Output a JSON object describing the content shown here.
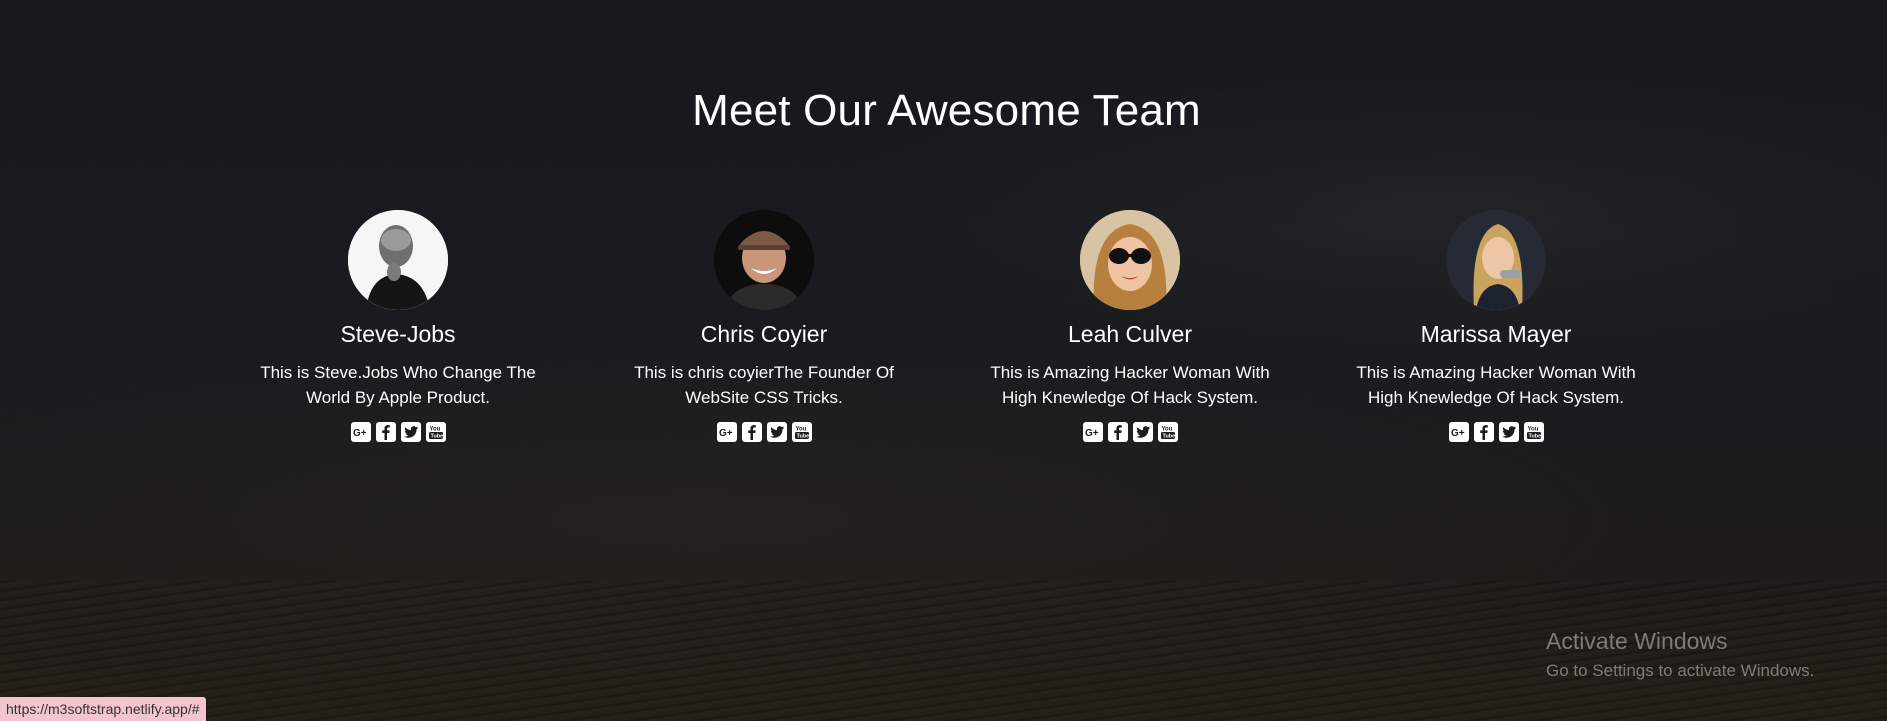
{
  "heading": "Meet Our Awesome Team",
  "team": [
    {
      "name": "Steve-Jobs",
      "desc": "This is Steve.Jobs Who Change The World By Apple Product."
    },
    {
      "name": "Chris Coyier",
      "desc": "This is chris coyierThe Founder Of WebSite CSS Tricks."
    },
    {
      "name": "Leah Culver",
      "desc": "This is Amazing Hacker Woman With High Knewledge Of Hack System."
    },
    {
      "name": "Marissa Mayer",
      "desc": "This is Amazing Hacker Woman With High Knewledge Of Hack System."
    }
  ],
  "social_icons": [
    "google-plus-icon",
    "facebook-icon",
    "twitter-icon",
    "youtube-icon"
  ],
  "watermark": {
    "line1": "Activate Windows",
    "line2": "Go to Settings to activate Windows."
  },
  "status_url": "https://m3softstrap.netlify.app/#"
}
